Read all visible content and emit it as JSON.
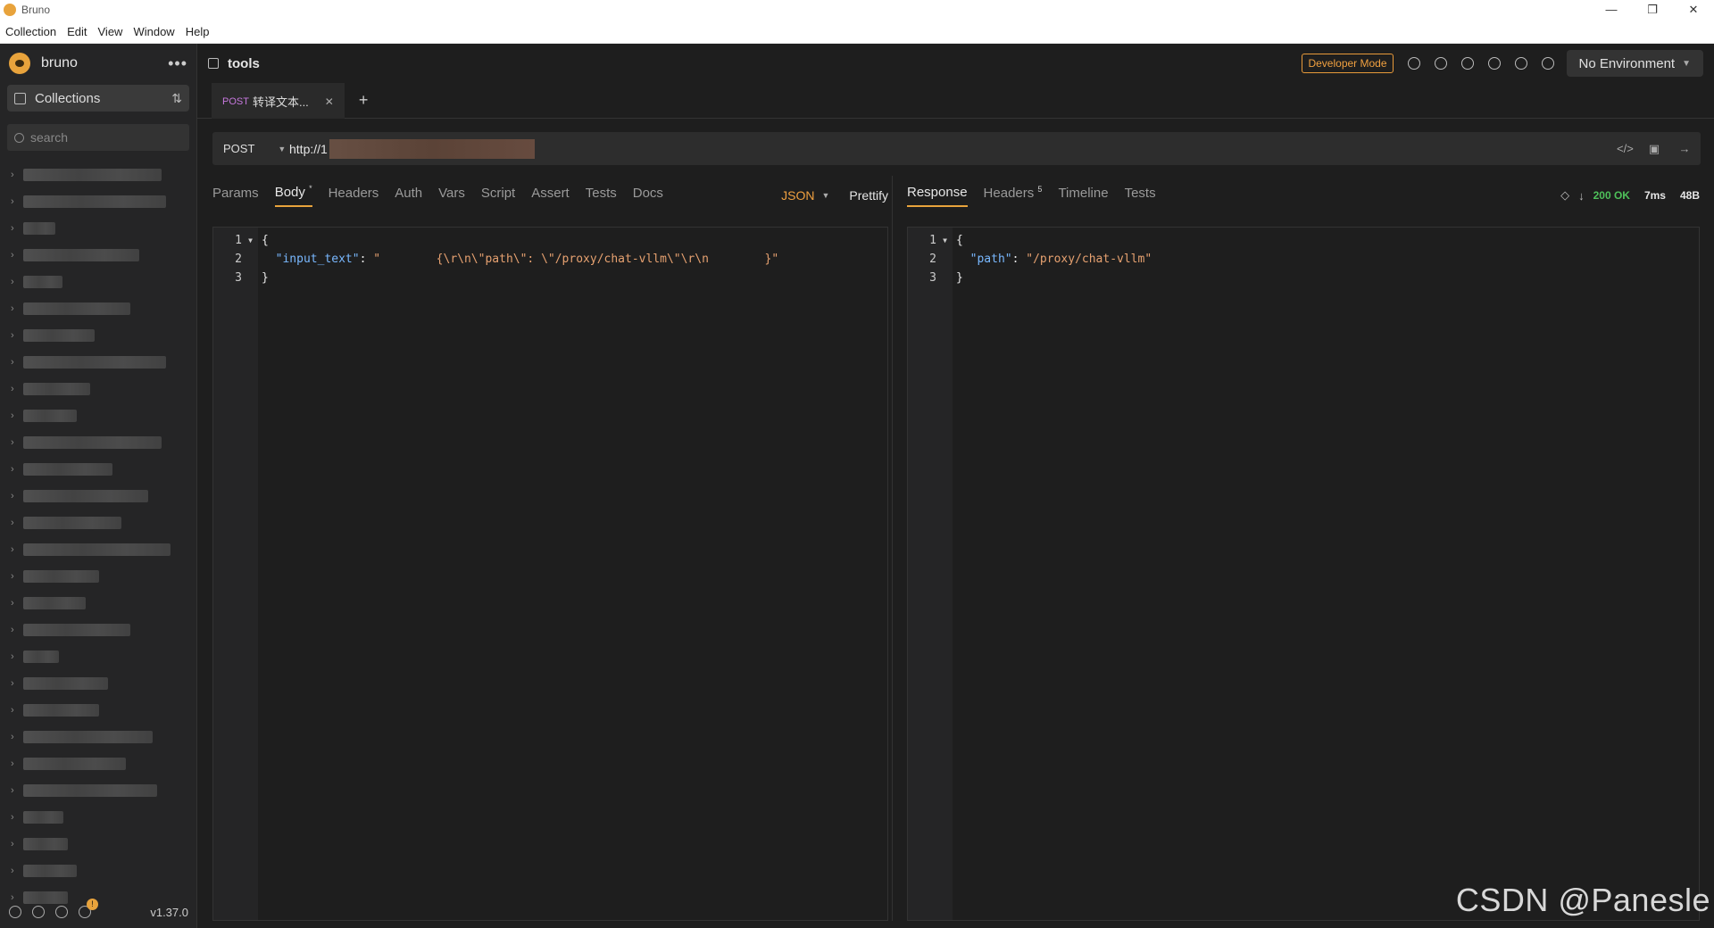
{
  "window": {
    "title": "Bruno",
    "controls": [
      "—",
      "❐",
      "✕"
    ]
  },
  "menu": [
    "Collection",
    "Edit",
    "View",
    "Window",
    "Help"
  ],
  "sidebar": {
    "app_name": "bruno",
    "more_label": "•••",
    "collections_label": "Collections",
    "sort_label": "⇅",
    "search_placeholder": "search",
    "tree_items": [
      "",
      "",
      "",
      "",
      "",
      "",
      "",
      "",
      "",
      "",
      "",
      "",
      "",
      "",
      "",
      "",
      "",
      "",
      "",
      "",
      "",
      "",
      "",
      "",
      "",
      "",
      "",
      ""
    ],
    "notification_count": "!",
    "version": "v1.37.0"
  },
  "header": {
    "collection_name": "tools",
    "developer_mode_label": "Developer Mode",
    "environment": "No Environment"
  },
  "tabs": [
    {
      "method": "POST",
      "label": "转译文本...",
      "close": "✕"
    }
  ],
  "add_tab_label": "+",
  "request": {
    "method": "POST",
    "url": "http://1",
    "tabs": [
      {
        "label": "Params",
        "active": false
      },
      {
        "label": "Body",
        "active": true,
        "marker": "*"
      },
      {
        "label": "Headers",
        "active": false
      },
      {
        "label": "Auth",
        "active": false
      },
      {
        "label": "Vars",
        "active": false
      },
      {
        "label": "Script",
        "active": false
      },
      {
        "label": "Assert",
        "active": false
      },
      {
        "label": "Tests",
        "active": false
      },
      {
        "label": "Docs",
        "active": false
      }
    ],
    "body_mode": "JSON",
    "prettify_label": "Prettify",
    "body_lines": [
      {
        "n": "1",
        "text": "{"
      },
      {
        "n": "2",
        "key": "\"input_text\"",
        "sep": ": ",
        "value": "\"        {\\r\\n\\\"path\\\": \\\"/proxy/chat-vllm\\\"\\r\\n        }\""
      },
      {
        "n": "3",
        "text": "}"
      }
    ]
  },
  "response": {
    "tabs": [
      {
        "label": "Response",
        "active": true
      },
      {
        "label": "Headers",
        "active": false,
        "count": "5"
      },
      {
        "label": "Timeline",
        "active": false
      },
      {
        "label": "Tests",
        "active": false
      }
    ],
    "status": "200 OK",
    "time": "7ms",
    "size": "48B",
    "body_lines": [
      {
        "n": "1",
        "text": "{"
      },
      {
        "n": "2",
        "key": "\"path\"",
        "sep": ": ",
        "value": "\"/proxy/chat-vllm\""
      },
      {
        "n": "3",
        "text": "}"
      }
    ]
  },
  "watermark": "CSDN @Panesle"
}
